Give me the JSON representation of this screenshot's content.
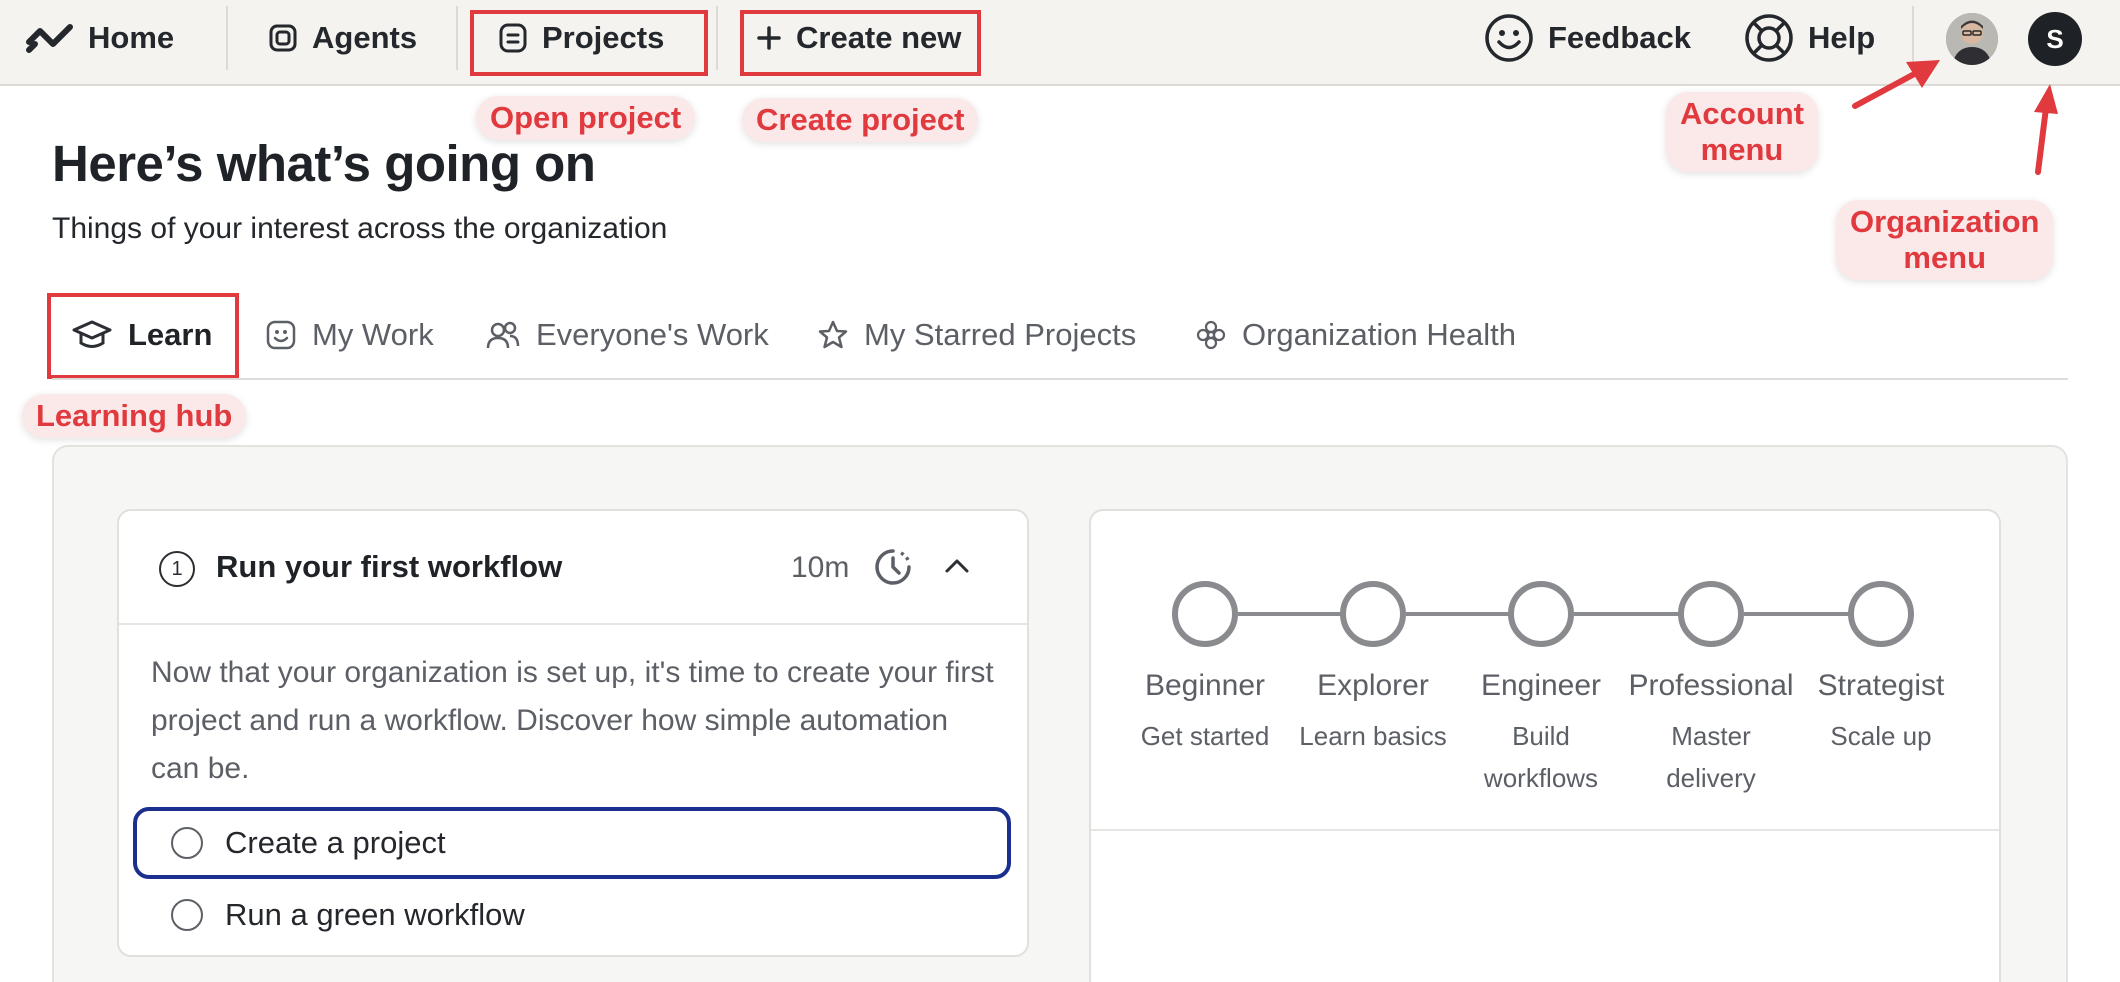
{
  "nav": {
    "home": "Home",
    "agents": "Agents",
    "projects": "Projects",
    "create_new": "Create new",
    "feedback": "Feedback",
    "help": "Help",
    "org_initial": "S"
  },
  "annotations": {
    "open_project": "Open project",
    "create_project": "Create project",
    "account_menu_line1": "Account",
    "account_menu_line2": "menu",
    "org_menu_line1": "Organization",
    "org_menu_line2": "menu",
    "learning_hub": "Learning hub",
    "color": "#e0393e"
  },
  "header": {
    "title": "Here’s what’s going on",
    "subtitle": "Things of your interest across the organization"
  },
  "tabs": [
    {
      "label": "Learn",
      "icon": "graduation-cap-icon",
      "active": true
    },
    {
      "label": "My Work",
      "icon": "smiley-icon",
      "active": false
    },
    {
      "label": "Everyone's Work",
      "icon": "users-icon",
      "active": false
    },
    {
      "label": "My Starred Projects",
      "icon": "star-icon",
      "active": false
    },
    {
      "label": "Organization Health",
      "icon": "flower-icon",
      "active": false
    }
  ],
  "workflow_card": {
    "step_number": "1",
    "title": "Run your first workflow",
    "duration": "10m",
    "description": "Now that your organization is set up, it's time to create your first project and run a workflow. Discover how simple automation can be.",
    "tasks": [
      {
        "label": "Create a project",
        "focused": true
      },
      {
        "label": "Run a green workflow",
        "focused": false
      }
    ]
  },
  "levels": [
    {
      "name": "Beginner",
      "desc": "Get started"
    },
    {
      "name": "Explorer",
      "desc": "Learn basics"
    },
    {
      "name": "Engineer",
      "desc": "Build workflows"
    },
    {
      "name": "Professional",
      "desc": "Master delivery"
    },
    {
      "name": "Strategist",
      "desc": "Scale up"
    }
  ],
  "colors": {
    "focus_ring": "#1b2f8f",
    "nav_background": "#f4f3ef"
  }
}
